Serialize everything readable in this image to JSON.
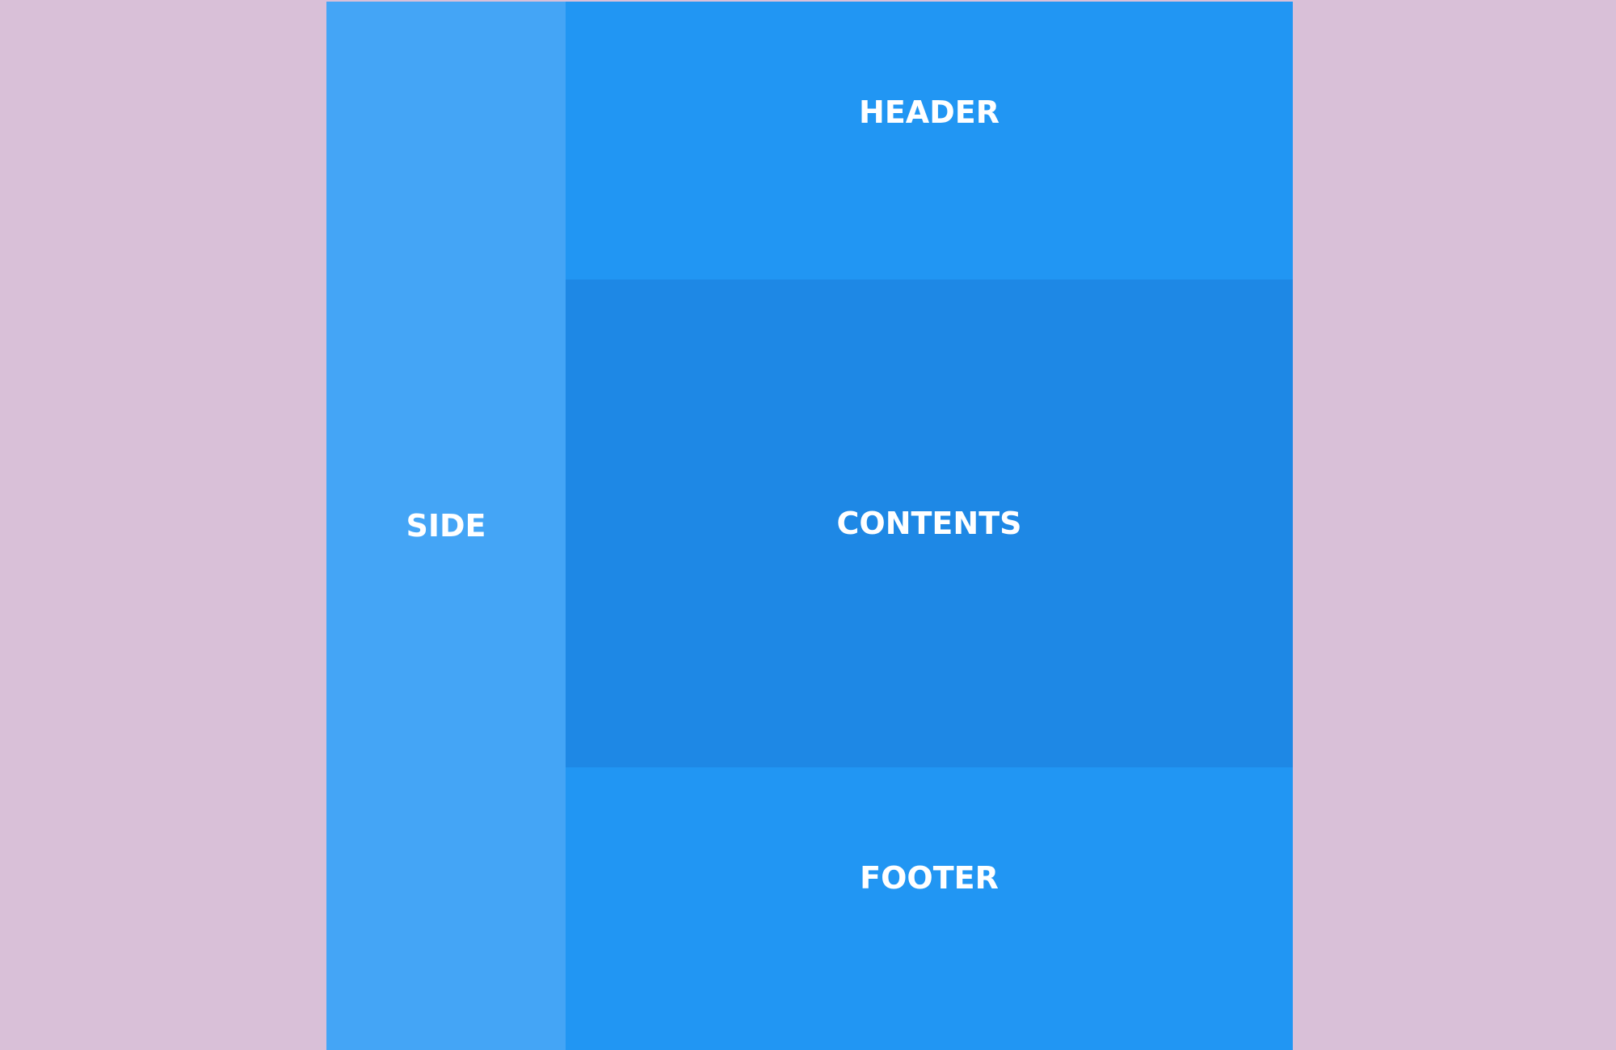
{
  "layout": {
    "side": {
      "label": "SIDE"
    },
    "header": {
      "label": "HEADER"
    },
    "contents": {
      "label": "CONTENTS"
    },
    "footer": {
      "label": "FOOTER"
    }
  },
  "colors": {
    "background": "#d9c0d8",
    "side": "#44a5f6",
    "header": "#2196f3",
    "contents": "#1e88e5",
    "footer": "#2196f3",
    "text": "#ffffff"
  }
}
